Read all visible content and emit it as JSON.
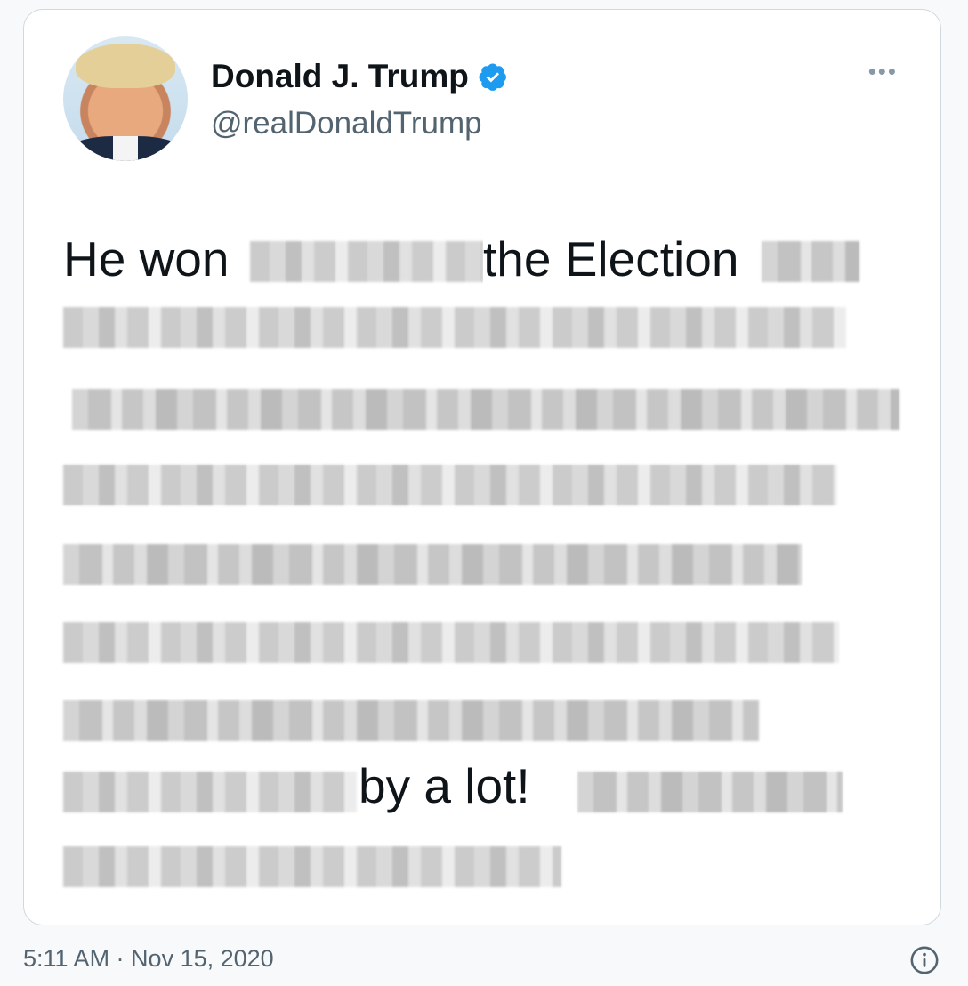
{
  "author": {
    "name": "Donald J. Trump",
    "handle": "@realDonaldTrump",
    "verified_icon": "verified-badge-icon",
    "avatar": "profile-photo"
  },
  "more_icon": "more-options-icon",
  "tweet": {
    "fragment_1": "He won",
    "fragment_2": "the Election",
    "fragment_3": "by a lot!"
  },
  "footer": {
    "timestamp": "5:11 AM · Nov 15, 2020",
    "info_icon": "info-icon"
  },
  "colors": {
    "verified": "#1d9bf0",
    "text_primary": "#0f1419",
    "text_secondary": "#536471",
    "border": "#cfd9de"
  }
}
